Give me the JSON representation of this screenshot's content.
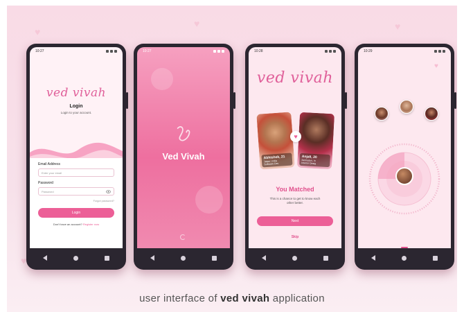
{
  "screens": {
    "login": {
      "time": "10:27",
      "brand": "ved vivah",
      "title": "Login",
      "subtitle": "Login to your account.",
      "email_label": "Email Address",
      "email_placeholder": "Enter your email",
      "password_label": "Password",
      "password_placeholder": "Password",
      "forgot": "Forgot password?",
      "login_button": "Login",
      "signup_prompt": "Don't have an account?",
      "signup_link": "Register now"
    },
    "splash": {
      "time": "10:27",
      "name": "Ved Vivah"
    },
    "match": {
      "time": "10:28",
      "brand": "ved vivah",
      "cards": [
        {
          "name": "Abhishek, 21",
          "loc": "Jaipur, India",
          "job": "Software Dev"
        },
        {
          "name": "Anjali, 20",
          "loc": "Dehradun, In",
          "job": "Interior Desig"
        }
      ],
      "matched_title": "You Matched",
      "matched_desc": "This is a chance to get to know each other better.",
      "next_button": "Next",
      "skip_link": "Skip"
    },
    "discover": {
      "time": "10:29"
    }
  },
  "caption": {
    "prefix": "user interface of ",
    "ved": "ved",
    "vivah": "vivah",
    "suffix": " application"
  },
  "colors": {
    "accent": "#ec5f97",
    "brand_script": "#e0609a",
    "background": "#f9dbe6"
  }
}
